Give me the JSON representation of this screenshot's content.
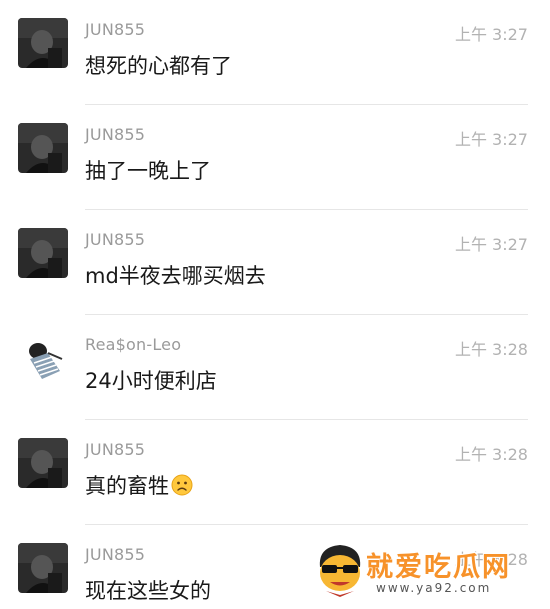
{
  "messages": [
    {
      "user": "JUN855",
      "time": "上午 3:27",
      "text": "想死的心都有了",
      "emoji": ""
    },
    {
      "user": "JUN855",
      "time": "上午 3:27",
      "text": "抽了一晚上了",
      "emoji": ""
    },
    {
      "user": "JUN855",
      "time": "上午 3:27",
      "text": "md半夜去哪买烟去",
      "emoji": ""
    },
    {
      "user": "Rea$on-Leo",
      "time": "上午 3:28",
      "text": "24小时便利店",
      "emoji": ""
    },
    {
      "user": "JUN855",
      "time": "上午 3:28",
      "text": "真的畜牲",
      "emoji": "frowning-face-icon"
    },
    {
      "user": "JUN855",
      "time": "上午 3:28",
      "text": "现在这些女的",
      "emoji": ""
    }
  ],
  "watermark": {
    "title": "就爱吃瓜网",
    "url": "www.ya92.com"
  },
  "colors": {
    "name": "#9a9a9a",
    "time": "#b2b2b2",
    "text": "#191919",
    "divider": "#e6e6e6",
    "watermark_orange": "#f7922a"
  }
}
